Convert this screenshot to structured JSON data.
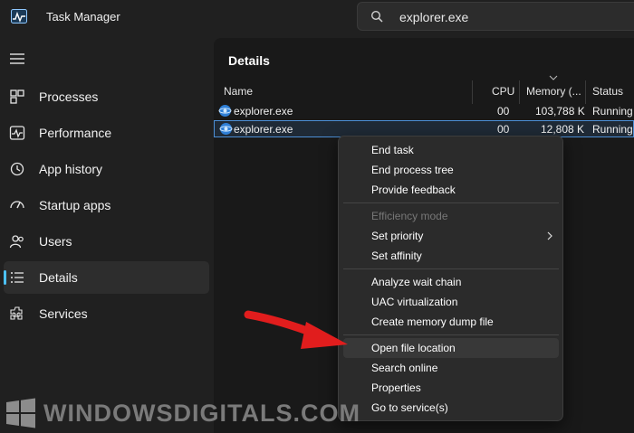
{
  "window": {
    "title": "Task Manager",
    "icon": "task-manager-icon"
  },
  "search": {
    "value": "explorer.exe",
    "icon": "search-icon"
  },
  "sidebar": {
    "items": [
      {
        "label": "Processes",
        "icon": "processes-icon"
      },
      {
        "label": "Performance",
        "icon": "performance-icon"
      },
      {
        "label": "App history",
        "icon": "app-history-icon"
      },
      {
        "label": "Startup apps",
        "icon": "startup-apps-icon"
      },
      {
        "label": "Users",
        "icon": "users-icon"
      },
      {
        "label": "Details",
        "icon": "details-icon",
        "active": true
      },
      {
        "label": "Services",
        "icon": "services-icon"
      }
    ]
  },
  "main": {
    "title": "Details",
    "columns": {
      "name": "Name",
      "cpu": "CPU",
      "memory": "Memory (...",
      "status": "Status"
    },
    "rows": [
      {
        "name": "explorer.exe",
        "cpu": "00",
        "memory": "103,788 K",
        "status": "Running"
      },
      {
        "name": "explorer.exe",
        "cpu": "00",
        "memory": "12,808 K",
        "status": "Running",
        "selected": true
      }
    ]
  },
  "context_menu": {
    "items": [
      {
        "label": "End task"
      },
      {
        "label": "End process tree"
      },
      {
        "label": "Provide feedback"
      },
      {
        "label": "Efficiency mode",
        "disabled": true
      },
      {
        "label": "Set priority",
        "has_submenu": true
      },
      {
        "label": "Set affinity"
      },
      {
        "label": "Analyze wait chain"
      },
      {
        "label": "UAC virtualization"
      },
      {
        "label": "Create memory dump file"
      },
      {
        "label": "Open file location",
        "highlighted": true
      },
      {
        "label": "Search online"
      },
      {
        "label": "Properties"
      },
      {
        "label": "Go to service(s)"
      }
    ]
  },
  "watermark": {
    "text": "WindowsDigitals.com",
    "display_text": "WINDOWSDIGITALS.COM"
  },
  "colors": {
    "accent": "#4cc2ff",
    "arrow": "#e11d1d",
    "background": "#202020"
  }
}
